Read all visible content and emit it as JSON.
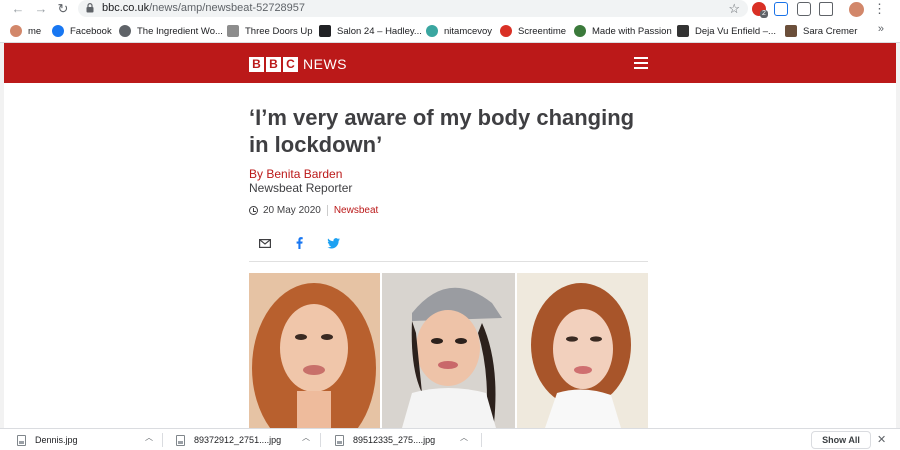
{
  "browser": {
    "url_host": "bbc.co.uk",
    "url_path": "/news/amp/newsbeat-52728957",
    "extension_badge": "2",
    "bookmarks": [
      {
        "label": "me",
        "icon": "avatar-icon",
        "color": "#d2876a"
      },
      {
        "label": "Facebook",
        "icon": "facebook-icon",
        "color": "#1877f2"
      },
      {
        "label": "The Ingredient Wo...",
        "icon": "globe-icon",
        "color": "#5f6368"
      },
      {
        "label": "Three Doors Up",
        "icon": "doc-icon",
        "color": "#8d8d8d"
      },
      {
        "label": "Salon 24 – Hadley...",
        "icon": "salon-24-icon",
        "color": "#202124"
      },
      {
        "label": "nitamcevoy",
        "icon": "chain-icon",
        "color": "#3aa6a0"
      },
      {
        "label": "Screentime",
        "icon": "screentime-icon",
        "color": "#d93025"
      },
      {
        "label": "Made with Passion",
        "icon": "leaf-icon",
        "color": "#3b7a3b"
      },
      {
        "label": "Deja Vu Enfield –...",
        "icon": "square-icon",
        "color": "#333333"
      },
      {
        "label": "Sara Cremer",
        "icon": "person-icon",
        "color": "#6b4f3a"
      }
    ],
    "bookmarks_more": "»"
  },
  "site": {
    "logo_letters": [
      "B",
      "B",
      "C"
    ],
    "logo_word": "NEWS",
    "brand_color": "#bb1919"
  },
  "article": {
    "headline": "‘I’m very aware of my body changing in lockdown’",
    "author": "By Benita Barden",
    "role": "Newsbeat Reporter",
    "date": "20 May 2020",
    "topic": "Newsbeat"
  },
  "downloads": {
    "items": [
      {
        "filename": "Dennis.jpg"
      },
      {
        "filename": "89372912_2751....jpg"
      },
      {
        "filename": "89512335_275....jpg"
      }
    ],
    "show_all": "Show All",
    "close": "✕"
  }
}
